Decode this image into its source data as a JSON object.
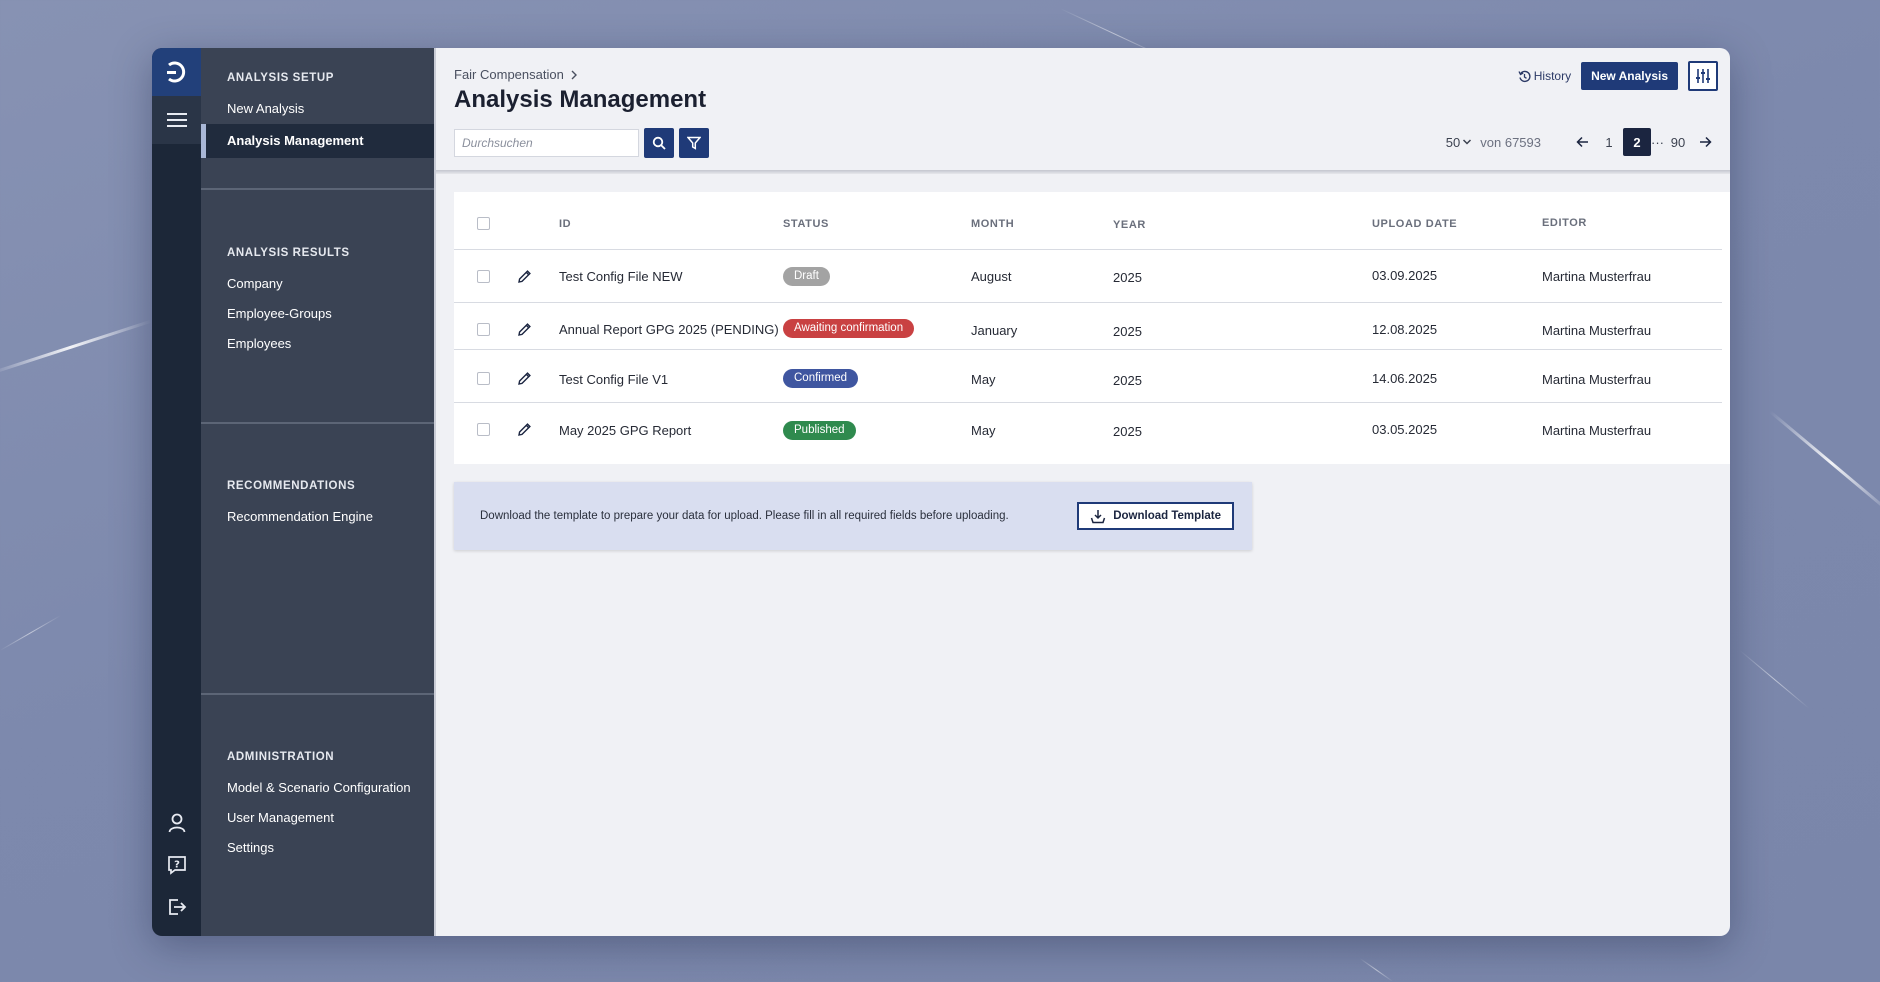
{
  "colors": {
    "accent": "#1f3a78",
    "sidebar_bg": "#3a4354",
    "rail_bg": "#1c2738",
    "badge_draft": "#a3a3a3",
    "badge_awaiting": "#c94142",
    "badge_confirmed": "#3f56a0",
    "badge_published": "#2f8a4e"
  },
  "rail": {
    "logo_icon": "brand-logo-icon",
    "menu_icon": "hamburger-menu-icon",
    "bottom_icons": [
      "user-icon",
      "help-icon",
      "logout-icon"
    ]
  },
  "sidebar": {
    "sections": [
      {
        "heading": "ANALYSIS SETUP",
        "items": [
          {
            "label": "New Analysis"
          },
          {
            "label": "Analysis Management",
            "active": true
          }
        ]
      },
      {
        "heading": "ANALYSIS RESULTS",
        "items": [
          {
            "label": "Company"
          },
          {
            "label": "Employee-Groups"
          },
          {
            "label": "Employees"
          }
        ]
      },
      {
        "heading": "RECOMMENDATIONS",
        "items": [
          {
            "label": "Recommendation Engine"
          }
        ]
      },
      {
        "heading": "ADMINISTRATION",
        "items": [
          {
            "label": "Model & Scenario Configuration"
          },
          {
            "label": "User Management"
          },
          {
            "label": "Settings"
          }
        ]
      }
    ]
  },
  "header": {
    "breadcrumb": "Fair Compensation",
    "title": "Analysis Management",
    "history_label": "History",
    "new_analysis_label": "New Analysis"
  },
  "search": {
    "placeholder": "Durchsuchen"
  },
  "pagination": {
    "per_page": "50",
    "total_text": "von 67593",
    "pages": [
      "1",
      "2",
      "···",
      "90"
    ],
    "current": "2"
  },
  "table": {
    "columns": {
      "id": "ID",
      "status": "STATUS",
      "month": "MONTH",
      "year": "YEAR",
      "upload_date": "UPLOAD DATE",
      "editor": "EDITOR"
    },
    "rows": [
      {
        "id": "Test Config File NEW",
        "status": "Draft",
        "month": "August",
        "year": "2025",
        "upload_date": "03.09.2025",
        "editor": "Martina Musterfrau"
      },
      {
        "id": "Annual Report GPG 2025 (PENDING)",
        "status": "Awaiting confirmation",
        "month": "January",
        "year": "2025",
        "upload_date": "12.08.2025",
        "editor": "Martina Musterfrau"
      },
      {
        "id": "Test Config File V1",
        "status": "Confirmed",
        "month": "May",
        "year": "2025",
        "upload_date": "14.06.2025",
        "editor": "Martina Musterfrau"
      },
      {
        "id": "May 2025 GPG Report",
        "status": "Published",
        "month": "May",
        "year": "2025",
        "upload_date": "03.05.2025",
        "editor": "Martina Musterfrau"
      }
    ]
  },
  "download": {
    "text": "Download the template to prepare your data for upload. Please fill in all required fields before uploading.",
    "button_label": "Download Template"
  }
}
